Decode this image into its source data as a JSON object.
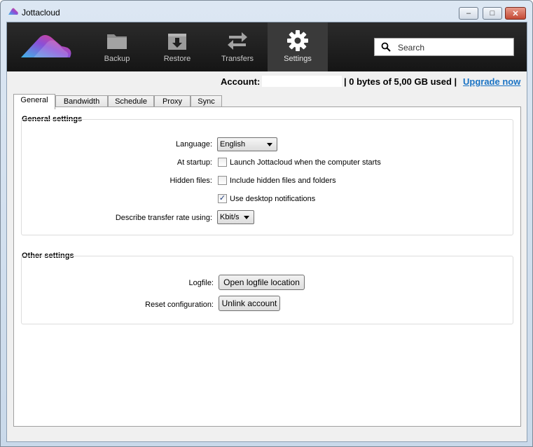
{
  "window": {
    "title": "Jottacloud",
    "minimize_glyph": "–",
    "maximize_glyph": "□",
    "close_glyph": "✕"
  },
  "toolbar": {
    "items": [
      {
        "label": "Backup",
        "icon": "folder-icon"
      },
      {
        "label": "Restore",
        "icon": "download-box-icon"
      },
      {
        "label": "Transfers",
        "icon": "transfer-arrows-icon"
      },
      {
        "label": "Settings",
        "icon": "gear-icon",
        "active": true
      }
    ],
    "search_placeholder": "Search"
  },
  "account": {
    "label": "Account:",
    "value": "",
    "usage": "| 0 bytes of 5,00 GB used |",
    "upgrade": "Upgrade now"
  },
  "tabs": [
    "General",
    "Bandwidth",
    "Schedule",
    "Proxy",
    "Sync"
  ],
  "general": {
    "title": "General settings",
    "language_label": "Language:",
    "language_value": "English",
    "startup_label": "At startup:",
    "startup_checkbox": "Launch Jottacloud when the computer starts",
    "startup_checked": false,
    "hidden_label": "Hidden files:",
    "hidden_checkbox": "Include hidden files and folders",
    "hidden_checked": false,
    "notify_checkbox": "Use desktop notifications",
    "notify_checked": true,
    "rate_label": "Describe transfer rate using:",
    "rate_value": "Kbit/s"
  },
  "other": {
    "title": "Other settings",
    "logfile_label": "Logfile:",
    "logfile_button": "Open logfile location",
    "reset_label": "Reset configuration:",
    "reset_button": "Unlink account"
  },
  "colors": {
    "toolbar_bg": "#1e1e1e",
    "active_tab_bg": "#3a3a3a",
    "link": "#1a73c4",
    "logo_gradient": [
      "#3fb6e8",
      "#8a4fd8",
      "#ef3d7a"
    ]
  }
}
